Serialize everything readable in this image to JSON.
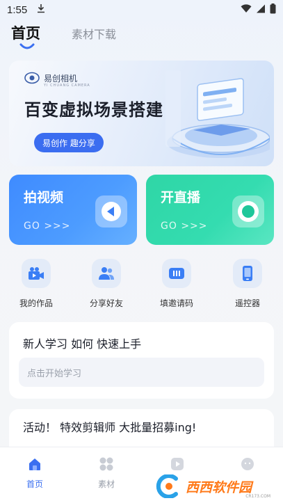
{
  "status_bar": {
    "time": "1:55",
    "icons": [
      "download-icon",
      "wifi-icon",
      "signal-icon",
      "battery-icon"
    ]
  },
  "top_tabs": [
    {
      "label": "首页",
      "active": true
    },
    {
      "label": "素材下载",
      "active": false
    }
  ],
  "banner": {
    "logo_text": "易创相机",
    "logo_sub": "YI CHUANG CAMERA",
    "title": "百变虚拟场景搭建",
    "pill": "易创作 趣分享"
  },
  "action_cards": [
    {
      "title": "拍视频",
      "go": "GO >>>",
      "color": "#4a95ff"
    },
    {
      "title": "开直播",
      "go": "GO >>>",
      "color": "#32d9ab"
    }
  ],
  "shortcuts": [
    {
      "label": "我的作品",
      "icon": "video-camera-icon"
    },
    {
      "label": "分享好友",
      "icon": "users-icon"
    },
    {
      "label": "填邀请码",
      "icon": "invite-code-icon"
    },
    {
      "label": "遥控器",
      "icon": "phone-remote-icon"
    }
  ],
  "learn": {
    "title": "新人学习 如何 快速上手",
    "placeholder": "点击开始学习"
  },
  "promo": {
    "title": "活动！ 特效剪辑师 大批量招募ing!"
  },
  "bottom_nav": [
    {
      "label": "首页",
      "icon": "home-icon",
      "active": true
    },
    {
      "label": "素材",
      "icon": "grid-icon",
      "active": false
    },
    {
      "label": "",
      "icon": "play-icon",
      "active": false
    },
    {
      "label": "",
      "icon": "profile-icon",
      "active": false
    }
  ],
  "watermark": {
    "text": "西西软件园",
    "sub": "CR173.COM"
  },
  "colors": {
    "accent": "#3a6ff0",
    "video_card": "#4a95ff",
    "live_card": "#32d9ab"
  }
}
